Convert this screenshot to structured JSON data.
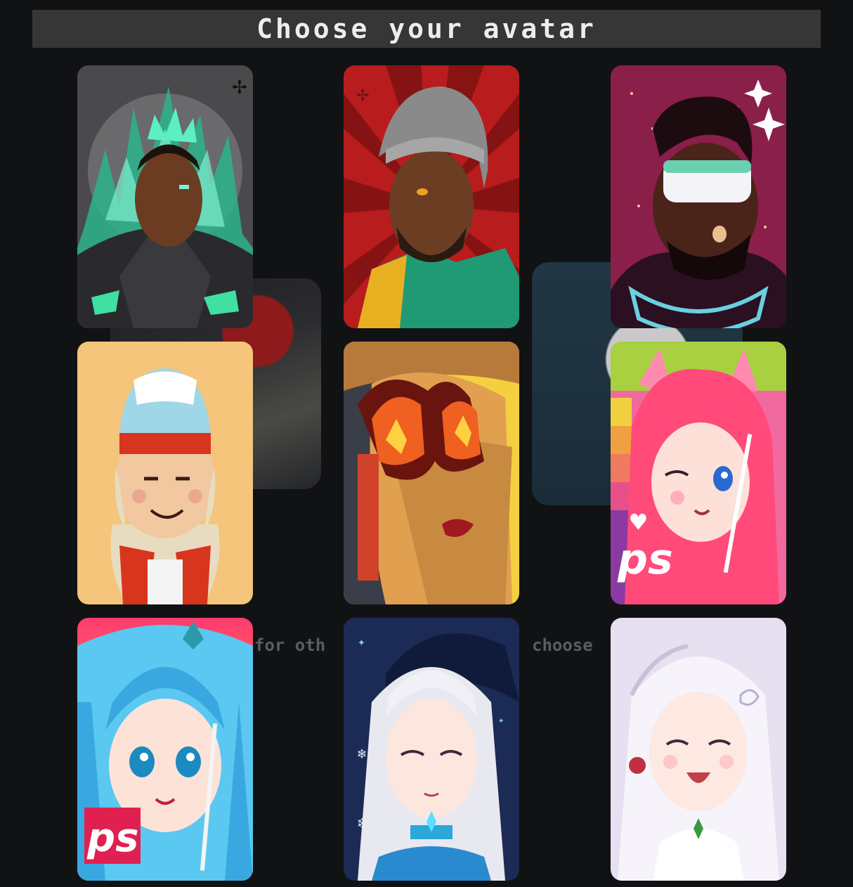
{
  "header": {
    "title": "Choose your avatar"
  },
  "background": {
    "hint_left": "for oth",
    "hint_right": "choose",
    "heart_icon": "heart-icon"
  },
  "avatars": [
    {
      "id": 1,
      "subject": "dark-knight-green-flame-crown",
      "accent": "#3fe0b0"
    },
    {
      "id": 2,
      "subject": "man-grey-beanie-green-jacket",
      "accent": "#b81c1c"
    },
    {
      "id": 3,
      "subject": "man-vr-visor-space-suit",
      "accent": "#8a1f4a"
    },
    {
      "id": 4,
      "subject": "kid-red-cap-orange-bg",
      "accent": "#f4c57a"
    },
    {
      "id": 5,
      "subject": "woman-heart-flame-goggles",
      "accent": "#f0b030"
    },
    {
      "id": 6,
      "subject": "pink-hair-cat-ears-girl",
      "accent": "#ff5a8a",
      "badge": "ps"
    },
    {
      "id": 7,
      "subject": "cyan-hair-girl-brush",
      "accent": "#5ac8f0",
      "badge": "ps"
    },
    {
      "id": 8,
      "subject": "white-hair-witch-girl",
      "accent": "#1c2b55"
    },
    {
      "id": 9,
      "subject": "white-hair-maiden-girl",
      "accent": "#e6e0f0"
    }
  ],
  "colors": {
    "page_bg": "#111214",
    "title_bar_bg": "#363636",
    "title_text": "#ededed"
  }
}
